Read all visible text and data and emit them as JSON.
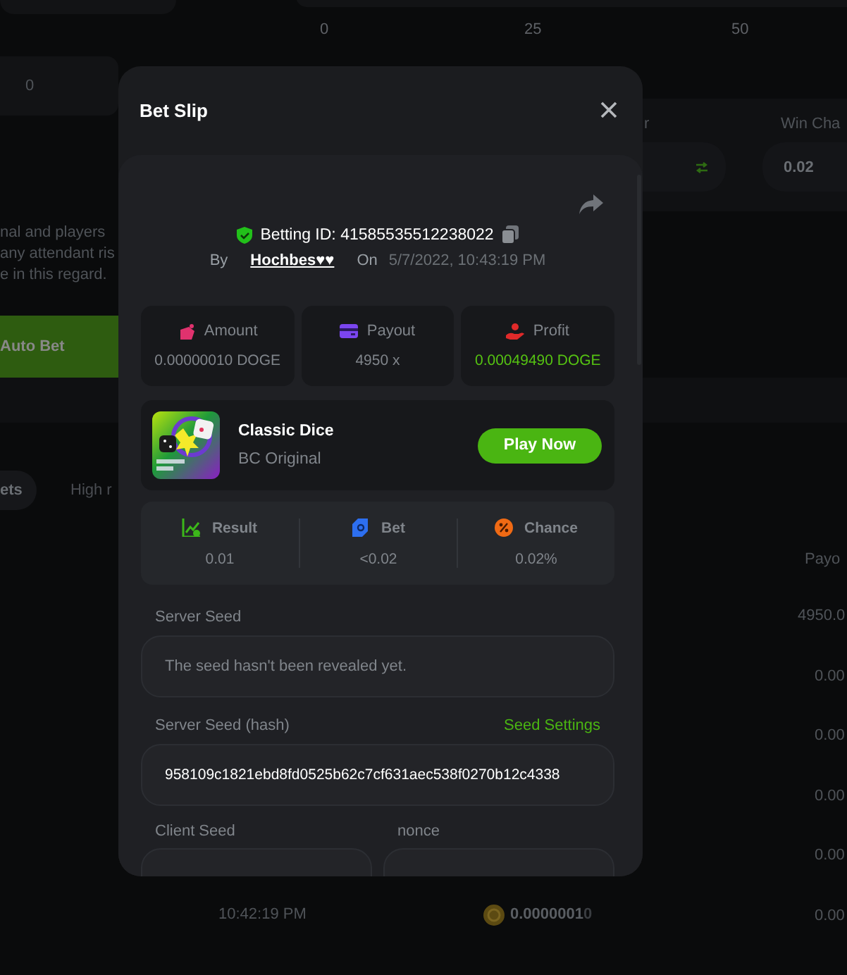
{
  "background": {
    "axis_ticks": [
      "0",
      "25",
      "50"
    ],
    "left_value": "0",
    "field_labels": [
      {
        "text": "r",
        "kind": "tail"
      },
      {
        "text": "Win Cha",
        "kind": "win"
      }
    ],
    "win_chance_value": "0.02",
    "notice_lines": [
      "nal and players",
      "any attendant ris",
      "e in this regard."
    ],
    "auto_bet_button": "Auto Bet",
    "tabs": [
      {
        "label": "ets",
        "selected": true
      },
      {
        "label": "High r",
        "selected": false
      }
    ],
    "payout_header": "Payo",
    "payout_values": [
      "4950.0",
      "0.00",
      "0.00",
      "0.00",
      "0.00",
      "0.00"
    ],
    "rows": [
      {
        "time": "10:42:19 PM",
        "amount": "0.0000001",
        "amount_tail": "0"
      }
    ]
  },
  "modal": {
    "title": "Bet Slip",
    "betting_id": "Betting ID: 41585535512238022",
    "by_label": "By",
    "user": "Hochbes♥♥",
    "on_label": "On",
    "date": "5/7/2022, 10:43:19 PM",
    "stats": [
      {
        "kind": "amount",
        "label": "Amount",
        "value": "0.00000010 DOGE"
      },
      {
        "kind": "payout",
        "label": "Payout",
        "value": "4950 x"
      },
      {
        "kind": "profit",
        "label": "Profit",
        "value": "0.00049490 DOGE"
      }
    ],
    "game": {
      "kind": "picture",
      "name": "Classic Dice",
      "provider": "BC Original",
      "button": "Play Now"
    },
    "results": [
      {
        "kind": "result",
        "label": "Result",
        "value": "0.01"
      },
      {
        "kind": "bet",
        "label": "Bet",
        "value": "<0.02"
      },
      {
        "kind": "chance",
        "label": "Chance",
        "value": "0.02%"
      }
    ],
    "server_seed": {
      "label": "Server Seed",
      "placeholder": "The seed hasn't been revealed yet."
    },
    "server_seed_hash": {
      "label": "Server Seed (hash)",
      "link": "Seed Settings",
      "value": "958109c1821ebd8fd0525b62c7cf631aec538f0270b12c4338"
    },
    "client_seed": {
      "label": "Client Seed"
    },
    "nonce": {
      "label": "nonce"
    }
  }
}
